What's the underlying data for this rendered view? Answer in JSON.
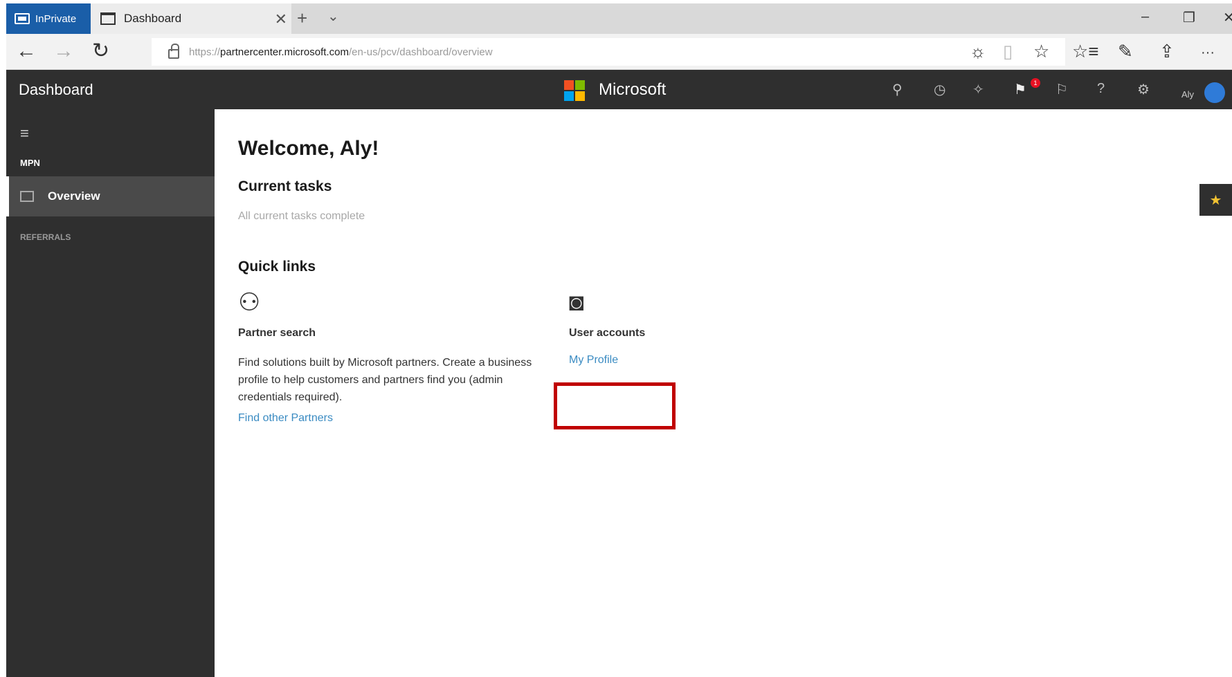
{
  "browser": {
    "inprivate_label": "InPrivate",
    "tab_title": "Dashboard",
    "tab_close": "✕",
    "new_tab": "+",
    "tab_menu": "⌄",
    "window_controls": {
      "minimize": "–",
      "restore": "❐",
      "close": "✕"
    },
    "nav": {
      "back": "←",
      "forward": "→",
      "refresh": "↻"
    },
    "url": {
      "scheme": "https://",
      "host": "partnercenter.microsoft.com",
      "path": "/en-us/pcv/dashboard/overview"
    },
    "toolbar_icons": {
      "reading": "☼",
      "reading_view": "▯",
      "favorite": "☆",
      "favorites_hub": "☆≡",
      "notes": "✎",
      "share": "⇪",
      "more": "···"
    }
  },
  "app": {
    "title": "Dashboard",
    "brand": "Microsoft",
    "brand_colors": [
      "#f25022",
      "#7fba00",
      "#00a4ef",
      "#ffb900"
    ],
    "header_icons": {
      "search": "⚲",
      "clock": "◷",
      "star": "✧",
      "notifications": "⚑",
      "badge_count": "1",
      "feedback": "⚐",
      "help": "?",
      "settings": "⚙"
    },
    "user_name": "Aly"
  },
  "sidebar": {
    "hamburger": "≡",
    "mpn_label": "MPN",
    "overview_label": "Overview",
    "referrals_label": "REFERRALS"
  },
  "main": {
    "welcome": "Welcome, Aly!",
    "current_tasks_heading": "Current tasks",
    "current_tasks_status": "All current tasks complete",
    "quick_links_heading": "Quick links",
    "partner_search": {
      "icon": "⚇",
      "title": "Partner search",
      "description": "Find solutions built by Microsoft partners. Create a business profile to help customers and partners find you (admin credentials required).",
      "link": "Find other Partners"
    },
    "user_accounts": {
      "icon": "◙",
      "title": "User accounts",
      "link": "My Profile"
    }
  },
  "side_tab": {
    "icon": "★"
  },
  "colors": {
    "header_bg": "#2f2f2f",
    "inprivate_bg": "#1a5ea8",
    "link": "#3a8bc2",
    "highlight": "#c00000"
  }
}
